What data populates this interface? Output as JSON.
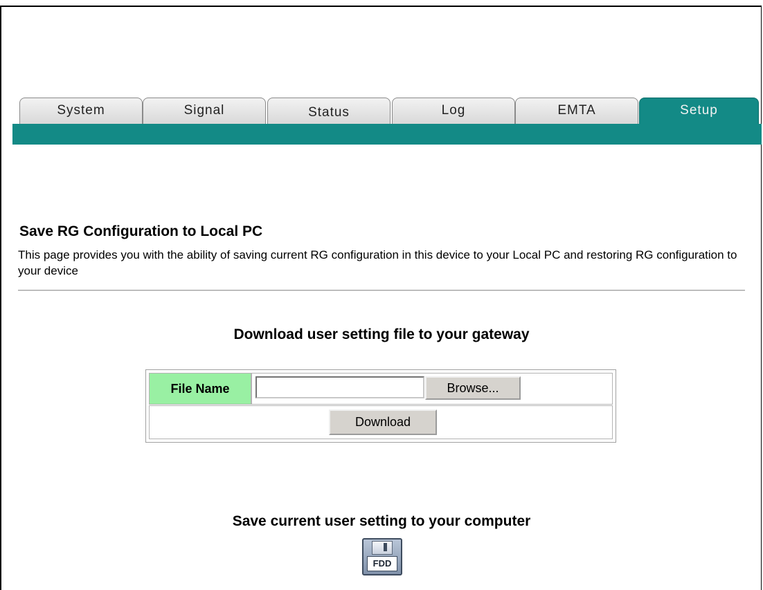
{
  "tabs": [
    {
      "label": "System",
      "active": false
    },
    {
      "label": "Signal",
      "active": false
    },
    {
      "label": "Status",
      "active": false
    },
    {
      "label": "Log",
      "active": false
    },
    {
      "label": "EMTA",
      "active": false
    },
    {
      "label": "Setup",
      "active": true
    }
  ],
  "page": {
    "title": "Save RG Configuration to Local PC",
    "description": "This page provides you with the ability of saving current RG configuration in this device to your Local PC and restoring RG configuration to your device"
  },
  "download_section": {
    "heading": "Download user setting file to your gateway",
    "file_name_label": "File Name",
    "file_name_value": "",
    "browse_label": "Browse...",
    "download_label": "Download"
  },
  "save_section": {
    "heading": "Save current user setting to your computer",
    "icon": "floppy-disk-icon",
    "icon_label": "FDD"
  },
  "colors": {
    "accent": "#138a86",
    "label_bg": "#99f0a3"
  }
}
